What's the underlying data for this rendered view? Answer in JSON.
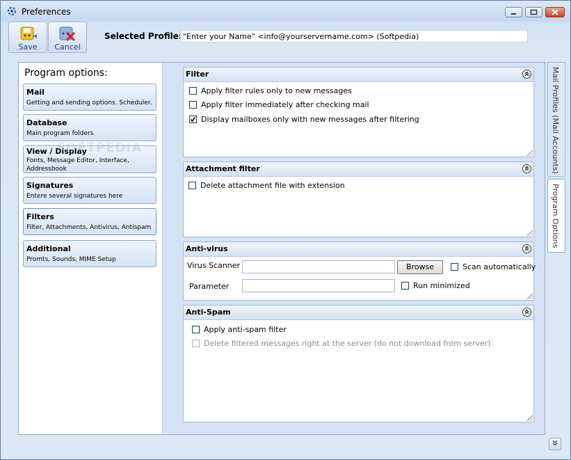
{
  "window": {
    "title": "Preferences"
  },
  "toolbar": {
    "save_label": "Save",
    "cancel_label": "Cancel"
  },
  "profile": {
    "label": "Selected Profile:",
    "value": "\"Enter your Name\" <info@yourservername.com> (Softpedia)"
  },
  "program_options": {
    "title": "Program options:",
    "items": [
      {
        "title": "Mail",
        "desc": "Getting and sending options. Scheduler."
      },
      {
        "title": "Database",
        "desc": "Main program folders"
      },
      {
        "title": "View / Display",
        "desc": "Fonts, Message Editor, Interface, Addressbook"
      },
      {
        "title": "Signatures",
        "desc": "Entere several signatures here"
      },
      {
        "title": "Filters",
        "desc": "Filter, Attachments, Antivirus, Antispam"
      },
      {
        "title": "Additional",
        "desc": "Promts, Sounds, MIME Setup"
      }
    ]
  },
  "watermark": "SOFTPEDIA",
  "filter": {
    "title": "Filter",
    "options": [
      {
        "label": "Apply filter rules only to new messages",
        "checked": false
      },
      {
        "label": "Apply filter immediately after checking mail",
        "checked": false
      },
      {
        "label": "Display mailboxes only with new messages after filtering",
        "checked": true
      }
    ]
  },
  "attachment_filter": {
    "title": "Attachment filter",
    "options": [
      {
        "label": "Delete attachment file with extension",
        "checked": false
      }
    ]
  },
  "antivirus": {
    "title": "Anti-virus",
    "scanner_label": "Virus Scanner",
    "scanner_value": "",
    "browse_label": "Browse",
    "scan_auto_label": "Scan automatically",
    "parameter_label": "Parameter",
    "parameter_value": "",
    "run_minimized_label": "Run minimized"
  },
  "antispam": {
    "title": "Anti-Spam",
    "options": [
      {
        "label": "Apply anti-spam filter",
        "checked": false,
        "disabled": false
      },
      {
        "label": "Delete filtered messages right at the server (do not download from server)",
        "checked": false,
        "disabled": true
      }
    ]
  },
  "side_tabs": {
    "mail_profiles": "Mail Profiles (Mail Accounts)",
    "program_options": "Program Options"
  },
  "icons": {
    "save": "save-icon",
    "cancel": "cancel-icon",
    "collapse": "double-chevron-up-icon",
    "corner": "double-chevron-down-icon"
  }
}
